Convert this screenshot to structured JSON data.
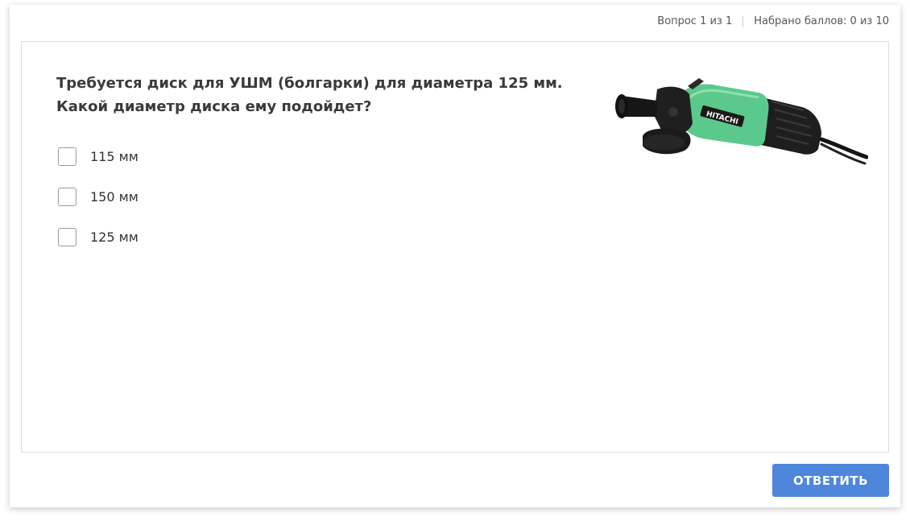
{
  "status": {
    "question_counter": "Вопрос 1 из 1",
    "score": "Набрано баллов: 0 из 10"
  },
  "question": {
    "line1": "Требуется диск для УШМ (болгарки) для диаметра 125 мм.",
    "line2": "Какой диаметр диска ему подойдет?",
    "image": {
      "icon": "angle-grinder-image",
      "brand_text": "HITACHI",
      "body_color": "#5cc98c",
      "dark_color": "#1e1e1e"
    },
    "options": [
      {
        "label": "115 мм",
        "checked": false
      },
      {
        "label": "150 мм",
        "checked": false
      },
      {
        "label": "125 мм",
        "checked": false
      }
    ]
  },
  "submit": {
    "label": "ОТВЕТИТЬ",
    "color": "#4d86da"
  }
}
